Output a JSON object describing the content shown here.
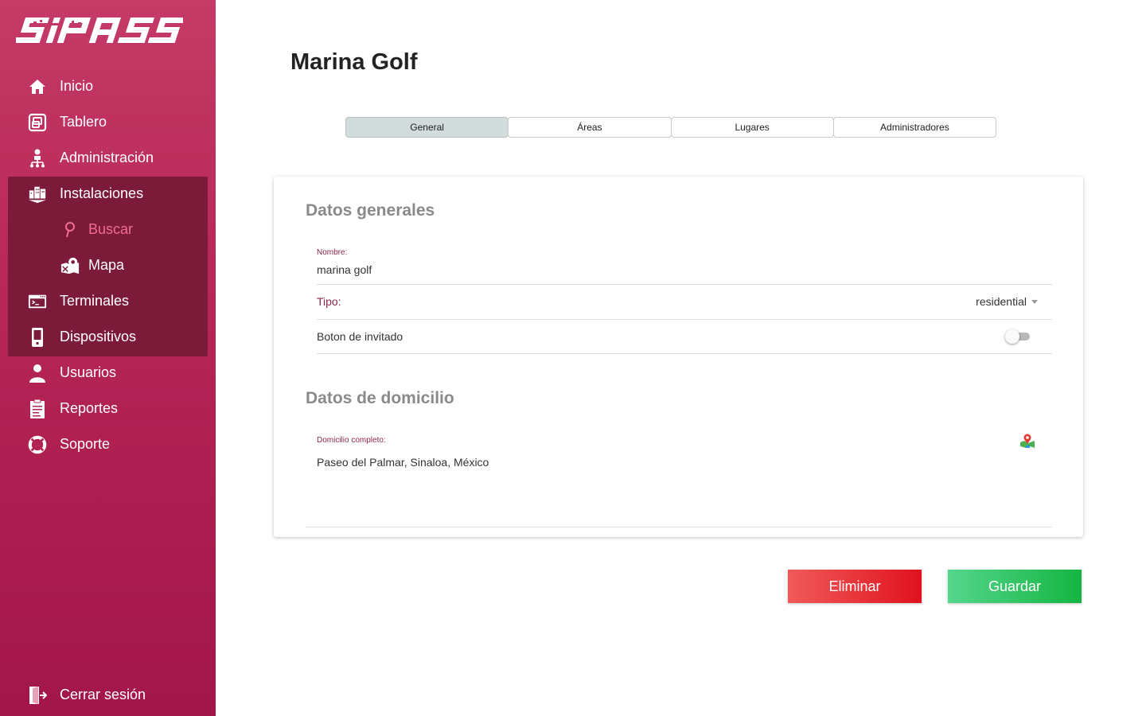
{
  "sidebar": {
    "logo_text": "SIPASS",
    "items": [
      {
        "label": "Inicio",
        "icon": "home-icon"
      },
      {
        "label": "Tablero",
        "icon": "dashboard-icon"
      },
      {
        "label": "Administración",
        "icon": "org-chart-icon"
      },
      {
        "label": "Instalaciones",
        "icon": "buildings-icon"
      },
      {
        "label": "Buscar",
        "icon": "search-icon"
      },
      {
        "label": "Mapa",
        "icon": "map-icon"
      },
      {
        "label": "Terminales",
        "icon": "terminal-icon"
      },
      {
        "label": "Dispositivos",
        "icon": "device-icon"
      },
      {
        "label": "Usuarios",
        "icon": "user-icon"
      },
      {
        "label": "Reportes",
        "icon": "report-icon"
      },
      {
        "label": "Soporte",
        "icon": "lifebuoy-icon"
      }
    ],
    "logout_label": "Cerrar sesión",
    "active_item": "Buscar"
  },
  "page": {
    "title": "Marina Golf"
  },
  "tabs": [
    {
      "label": "General",
      "active": true
    },
    {
      "label": "Áreas",
      "active": false
    },
    {
      "label": "Lugares",
      "active": false
    },
    {
      "label": "Administradores",
      "active": false
    }
  ],
  "general": {
    "section_title": "Datos generales",
    "nombre_label": "Nombre:",
    "nombre_value": "marina golf",
    "tipo_label": "Tipo:",
    "tipo_value": "residential",
    "boton_label": "Boton de invitado",
    "boton_enabled": false
  },
  "domicilio": {
    "section_title": "Datos de domicilio",
    "label": "Domicilio completo:",
    "value": "Paseo del Palmar, Sinaloa, México"
  },
  "actions": {
    "delete_label": "Eliminar",
    "save_label": "Guardar"
  },
  "colors": {
    "sidebar_top": "#c53a66",
    "sidebar_bottom": "#a3164a",
    "group_bg": "#7c1a3a",
    "active_text": "#f26d95",
    "delete": "#e0121e",
    "save": "#14b542"
  }
}
